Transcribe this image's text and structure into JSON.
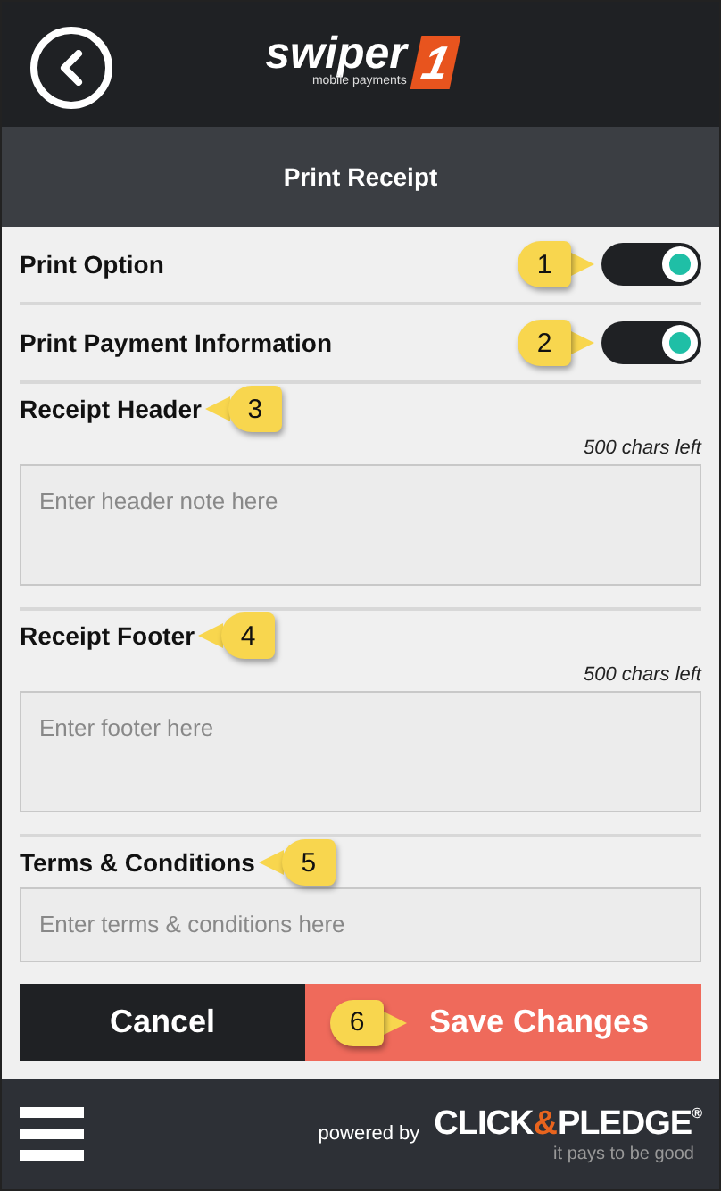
{
  "header": {
    "logo": {
      "word": "swiper",
      "mark": "1",
      "tagline": "mobile payments"
    }
  },
  "title_bar": {
    "title": "Print Receipt"
  },
  "toggles": [
    {
      "label": "Print Option",
      "on": true,
      "callout": "1"
    },
    {
      "label": "Print Payment Information",
      "on": true,
      "callout": "2"
    }
  ],
  "notes": [
    {
      "label": "Receipt Header",
      "callout": "3",
      "counter": "500 chars left",
      "placeholder": "Enter header note here"
    },
    {
      "label": "Receipt Footer",
      "callout": "4",
      "counter": "500 chars left",
      "placeholder": "Enter footer here"
    },
    {
      "label": "Terms & Conditions",
      "callout": "5",
      "placeholder": "Enter terms & conditions here"
    }
  ],
  "buttons": [
    {
      "kind": "cancel",
      "label": "Cancel"
    },
    {
      "kind": "save",
      "label": "Save Changes",
      "callout": "6"
    }
  ],
  "footer": {
    "powered_by": "powered by",
    "brand_left": "CLICK",
    "brand_amp": "&",
    "brand_right": "PLEDGE$^{®}$",
    "slogan": "it pays to be good"
  }
}
